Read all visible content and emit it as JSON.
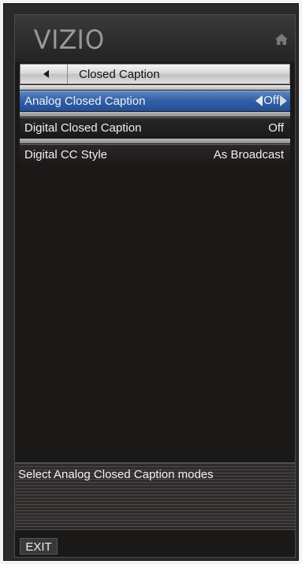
{
  "brand": {
    "logo_text": "VIZIO"
  },
  "header": {
    "home_icon": "home-icon"
  },
  "breadcrumb": {
    "back_icon": "left-triangle-icon",
    "title": "Closed Caption"
  },
  "menu": {
    "items": [
      {
        "label": "Analog Closed Caption",
        "value": "Off",
        "selected": true
      },
      {
        "label": "Digital Closed Caption",
        "value": "Off",
        "selected": false
      },
      {
        "label": "Digital CC Style",
        "value": "As Broadcast",
        "selected": false
      }
    ]
  },
  "help": {
    "text": "Select Analog Closed Caption modes"
  },
  "footer": {
    "exit_label": "EXIT"
  },
  "colors": {
    "selected_row": "#2f5ea7",
    "background": "#1b1818",
    "text": "#f0f0f0"
  }
}
